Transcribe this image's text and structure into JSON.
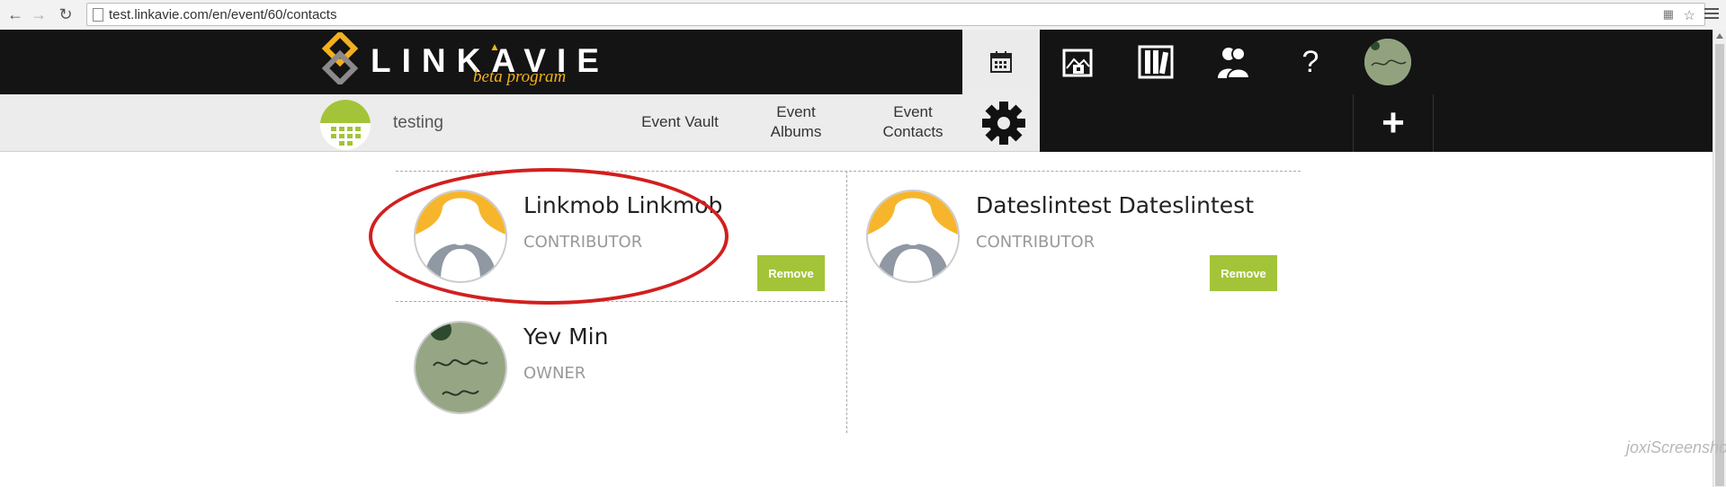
{
  "browser": {
    "url": "test.linkavie.com/en/event/60/contacts"
  },
  "header": {
    "logo_text": "LINKAVIE",
    "logo_sub": "beta program",
    "help_label": "?"
  },
  "subnav": {
    "event_name": "testing",
    "links": [
      {
        "line1": "Event Vault",
        "line2": ""
      },
      {
        "line1": "Event",
        "line2": "Albums"
      },
      {
        "line1": "Event",
        "line2": "Contacts"
      }
    ],
    "add_label": "+"
  },
  "contacts": [
    {
      "name": "Linkmob Linkmob",
      "role": "CONTRIBUTOR",
      "action": "Remove",
      "avatar": "default-user-icon"
    },
    {
      "name": "Dateslintest Dateslintest",
      "role": "CONTRIBUTOR",
      "action": "Remove",
      "avatar": "default-user-icon"
    },
    {
      "name": "Yev Min",
      "role": "OWNER",
      "action": "",
      "avatar": "photo-avatar"
    }
  ],
  "watermark": "joxiScreenshot",
  "colors": {
    "topbar": "#141414",
    "accent_yellow": "#f2b01e",
    "button_green": "#a3c439",
    "highlight_red": "#d21f1f"
  }
}
